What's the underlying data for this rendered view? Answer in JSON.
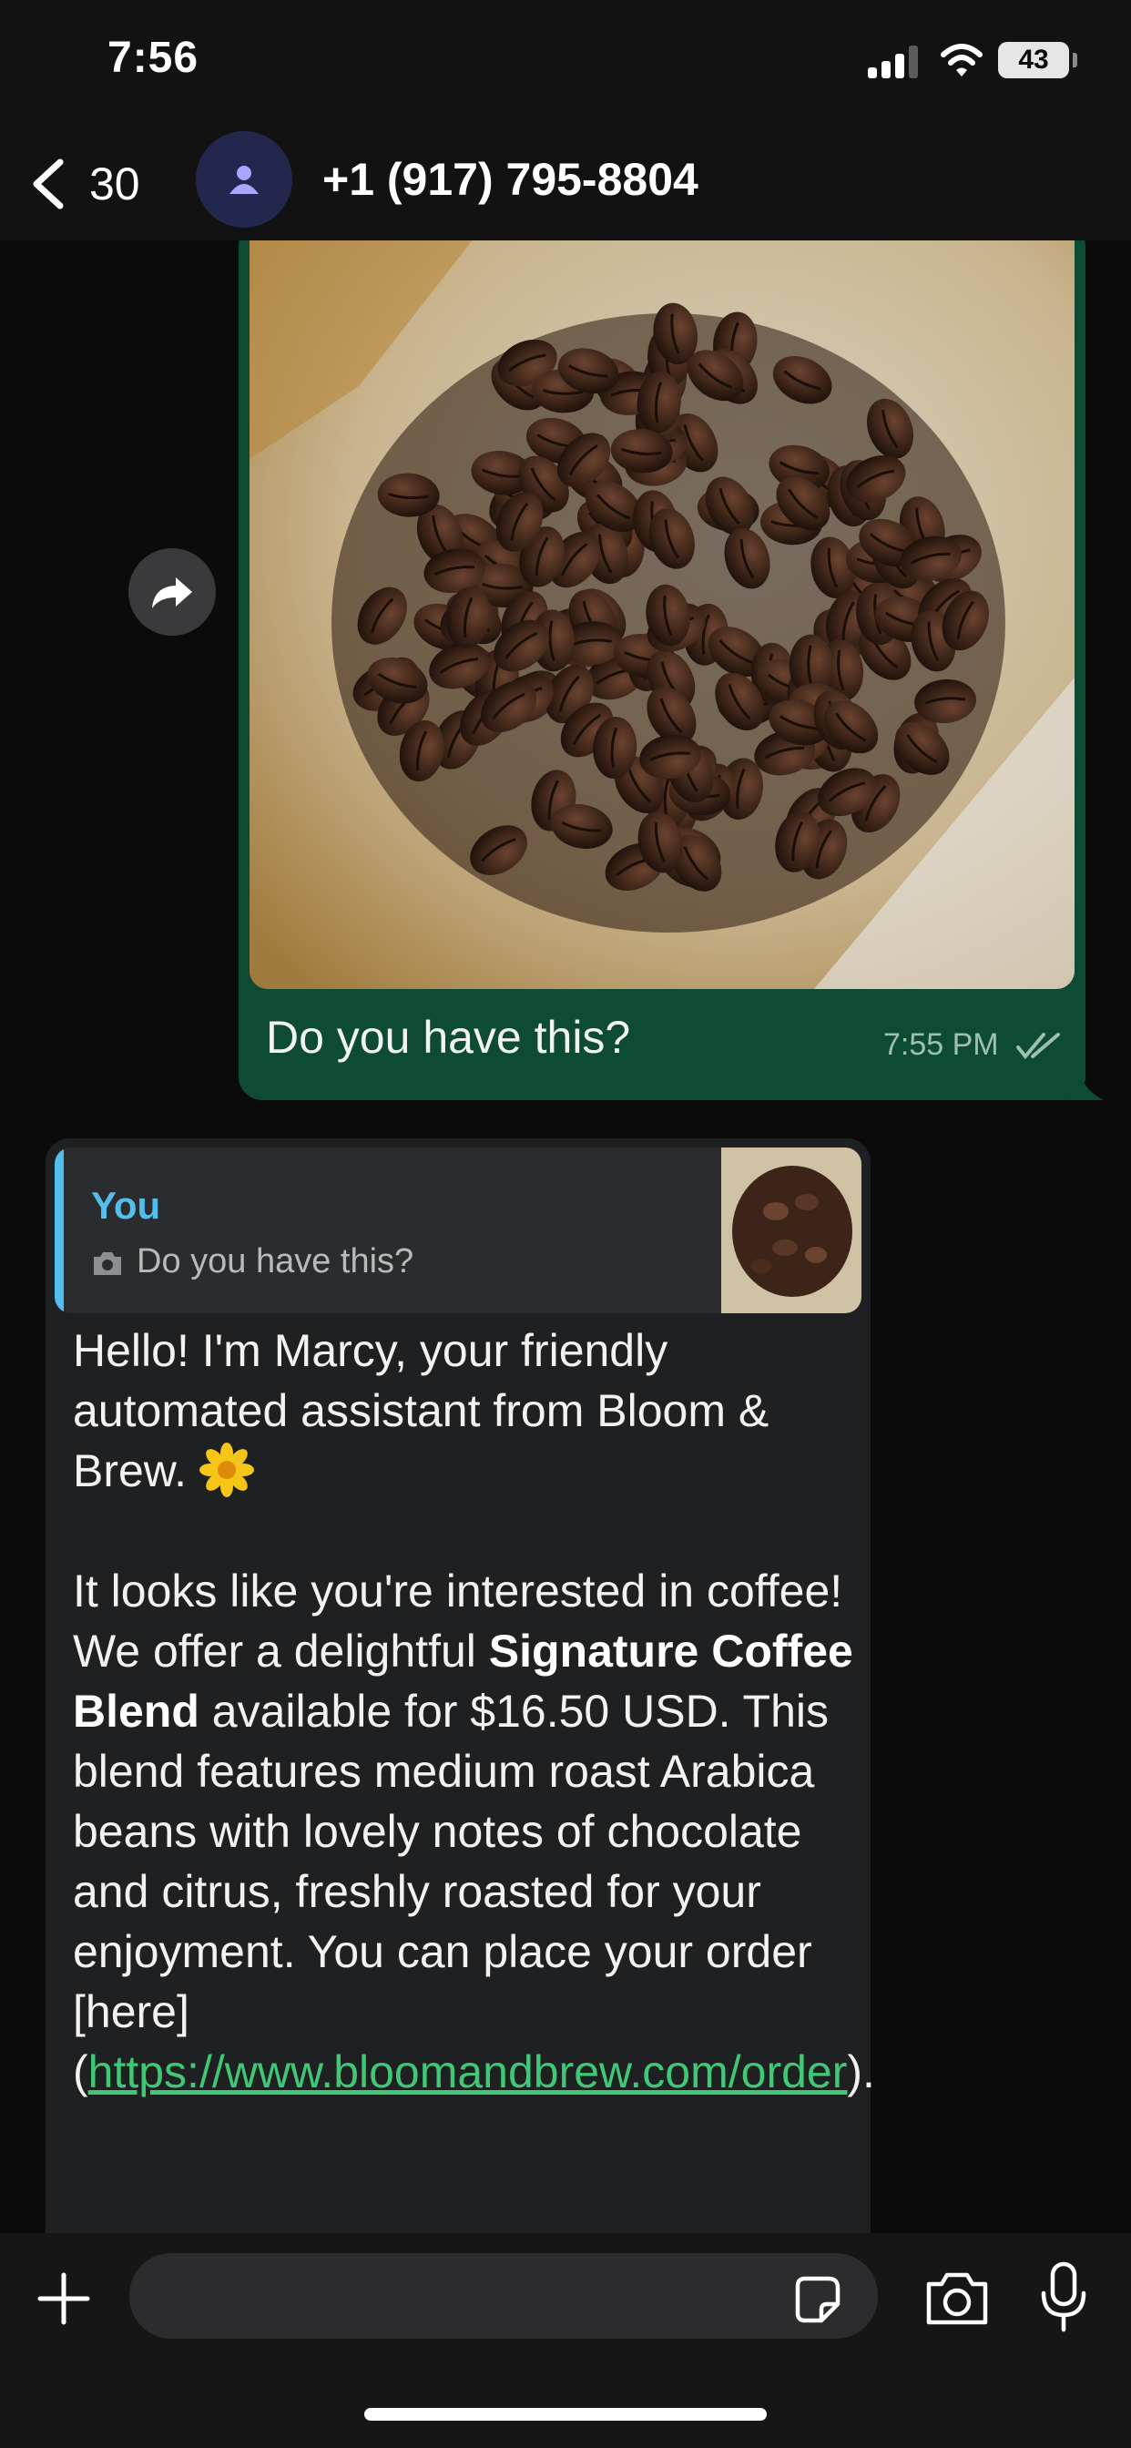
{
  "status_bar": {
    "time": "7:56",
    "battery": "43"
  },
  "header": {
    "back_count": "30",
    "contact_name": "+1 (917) 795-8804"
  },
  "messages": {
    "outgoing": {
      "caption": "Do you have this?",
      "time": "7:55 PM",
      "status": "read"
    },
    "incoming": {
      "quote_author": "You",
      "quote_text": "Do you have this?",
      "line1": "Hello! I'm Marcy, your friendly automated assistant from Bloom & Brew.",
      "para2_pre": "It looks like you're interested in coffee! We offer a delightful ",
      "para2_bold": "Signature Coffee Blend",
      "para2_post": " available for $16.50 USD. This blend features medium roast Arabica beans with lovely notes of chocolate and citrus, freshly roasted for your enjoyment. You can place your order [here](",
      "link": "https://www.bloomandbrew.com/order",
      "para2_end": ")."
    }
  },
  "composer": {
    "placeholder": ""
  },
  "colors": {
    "outgoing_bubble": "#0d4b33",
    "incoming_bubble": "#1f2021",
    "link": "#3fc876",
    "quote_accent": "#53bdeb"
  },
  "icons": [
    "back-chevron-icon",
    "person-icon",
    "forward-icon",
    "double-check-icon",
    "camera-icon",
    "plus-icon",
    "sticker-icon",
    "microphone-icon"
  ]
}
